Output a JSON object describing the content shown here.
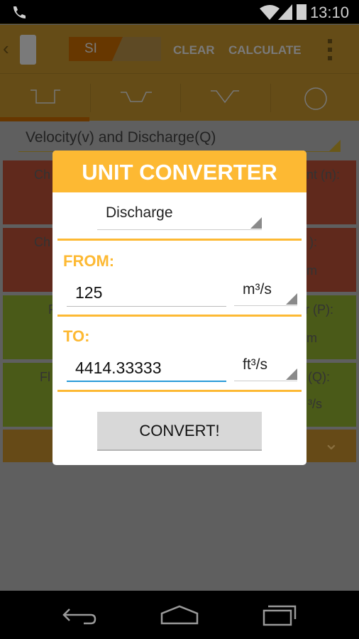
{
  "status": {
    "time": "13:10"
  },
  "appbar": {
    "unit_on": "SI",
    "clear": "CLEAR",
    "calculate": "CALCULATE"
  },
  "tabs": [
    "rectangular-channel-icon",
    "trapezoidal-channel-icon",
    "triangular-channel-icon",
    "circular-channel-icon"
  ],
  "spinner": "Velocity(v) and Discharge(Q)",
  "rows": [
    {
      "left": "Ch",
      "right": "nt (n):",
      "unit": ""
    },
    {
      "left": "Ch",
      "right": "):",
      "unit": "m"
    },
    {
      "left": "F",
      "right": "r (P):",
      "unit": "m"
    },
    {
      "left": "Fl",
      "right": "(Q):",
      "unit": "³/s"
    }
  ],
  "dialog": {
    "title": "UNIT CONVERTER",
    "quantity": "Discharge",
    "from_label": "FROM:",
    "from_value": "125",
    "from_unit": "m³/s",
    "to_label": "TO:",
    "to_value": "4414.33333",
    "to_unit": "ft³/s",
    "convert": "CONVERT!"
  },
  "colors": {
    "accent": "#fdb933",
    "focus": "#2a9bd8"
  }
}
